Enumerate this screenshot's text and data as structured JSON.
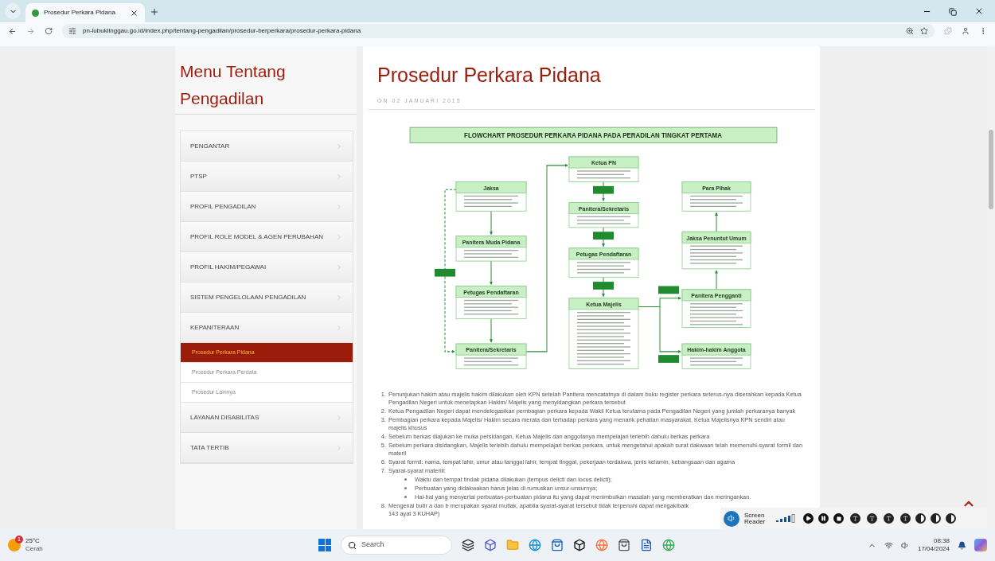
{
  "browser": {
    "tab": {
      "title": "Prosedur Perkara Pidana"
    },
    "url": "pn-lubuklinggau.go.id/index.php/tentang-pengadilan/prosedur-berperkara/prosedur-perkara-pidana"
  },
  "sidebar": {
    "title": "Menu Tentang Pengadilan",
    "items": [
      {
        "label": "PENGANTAR",
        "kind": "main",
        "selected": false
      },
      {
        "label": "PTSP",
        "kind": "main",
        "selected": false
      },
      {
        "label": "PROFIL PENGADILAN",
        "kind": "main",
        "selected": false
      },
      {
        "label": "PROFIL ROLE MODEL & AGEN PERUBAHAN",
        "kind": "main",
        "selected": false
      },
      {
        "label": "PROFIL HAKIM/PEGAWAI",
        "kind": "main",
        "selected": false
      },
      {
        "label": "SISTEM PENGELOLAAN PENGADILAN",
        "kind": "main",
        "selected": false
      },
      {
        "label": "KEPANITERAAN",
        "kind": "main",
        "selected": false
      },
      {
        "label": "Prosedur Perkara Pidana",
        "kind": "sub",
        "selected": true
      },
      {
        "label": "Prosedur Perkara Perdata",
        "kind": "sub",
        "selected": false
      },
      {
        "label": "Prosedur Lainnya",
        "kind": "sub",
        "selected": false
      },
      {
        "label": "LAYANAN DISABILITAS",
        "kind": "main",
        "selected": false
      },
      {
        "label": "TATA TERTIB",
        "kind": "main",
        "selected": false
      }
    ]
  },
  "article": {
    "title": "Prosedur Perkara Pidana",
    "date": "ON 02 JANUARI 2015",
    "flowchart": {
      "title": "FLOWCHART PROSEDUR PERKARA PIDANA PADA PERADILAN TINGKAT PERTAMA",
      "nodes": [
        {
          "title": "Jaksa"
        },
        {
          "title": "Panitera Muda Pidana"
        },
        {
          "title": "Petugas Pendaftaran"
        },
        {
          "title": "Panitera/Sekretaris"
        },
        {
          "title": "Ketua PN"
        },
        {
          "title": "Panitera/Sekretaris"
        },
        {
          "title": "Petugas Pendaftaran"
        },
        {
          "title": "Ketua Majelis"
        },
        {
          "title": "Para Pihak"
        },
        {
          "title": "Jaksa Penuntut Umum"
        },
        {
          "title": "Panitera Pengganti"
        },
        {
          "title": "Hakim-hakim Anggota"
        }
      ]
    },
    "list": [
      {
        "number": "1.",
        "text": "Penunjukan hakim atau majelis hakim dilakukan oleh KPN setelah Panitera mencatatnya di dalam buku register perkara seterus-nya diserahkan kepada Ketua Pengadilan Negeri untuk menetapkan Hakim/ Majelis yang menyidangkan perkara tersebut"
      },
      {
        "number": "2.",
        "text": "Ketua Pengadilan Negeri dapat mendelegasikan pembagian perkara kepada Wakil Ketua terutama pada Pengadilan Negeri yang jumlah perkaranya banyak"
      },
      {
        "number": "3.",
        "text": "Pembagian perkara kepada Majelis/ Hakim secara merata dan terhadap perkara yang menarik pehatian masyarakat, Ketua Majelisnya KPN sendiri atau majelis khusus"
      },
      {
        "number": "4.",
        "text": "Sebelum berkas diajukan ke muka persidangan, Ketua Majelis dan anggotanya mempelajari terlebih dahulu berkas perkara"
      },
      {
        "number": "5.",
        "text": "Sebelum perkara disidangkan, Majelis terlebih dahulu mempelajari berkas perkara, untuk mengetahui apakah surat dakwaan telah memenuhi-syarat formil dan materil"
      },
      {
        "number": "6.",
        "text": "Syarat formil: nama, tempat lahir, umur atau tanggal lahir, tempat tinggal, pekerjaan terdakwa, jenis kelamin, kebangsaan dan agama"
      },
      {
        "number": "7.",
        "text": "Syarat-syarat materiil:",
        "children": [
          {
            "text": "Waktu dan tempat tindak pidana dilakukan (tempus delicti dan locus delicti);"
          },
          {
            "text": "Perbuatan yang didakwakan harus jelas di-rumuskan unsur-unsurnya;"
          },
          {
            "text": "Hal-hal yang menyertai perbuatan-perbuatan pidana itu yang dapat menimbulkan masalah yang memberatkan dan meringankan."
          }
        ]
      },
      {
        "number": "8.",
        "text": "Mengenai butir a dan b merupakan syarat mutlak, apabila syarat-syarat tersebut tidak terpenuhi dapat mengakibatk",
        "text_2": "143 ayat 3 KUHAP)"
      }
    ]
  },
  "screen_reader": {
    "label": "Screen Reader"
  },
  "taskbar": {
    "weather": {
      "badge": "1",
      "temperature": "25°C",
      "condition": "Cerah"
    },
    "search": {
      "placeholder": "Search"
    },
    "clock": {
      "time": "08:38",
      "date": "17/04/2024"
    }
  }
}
